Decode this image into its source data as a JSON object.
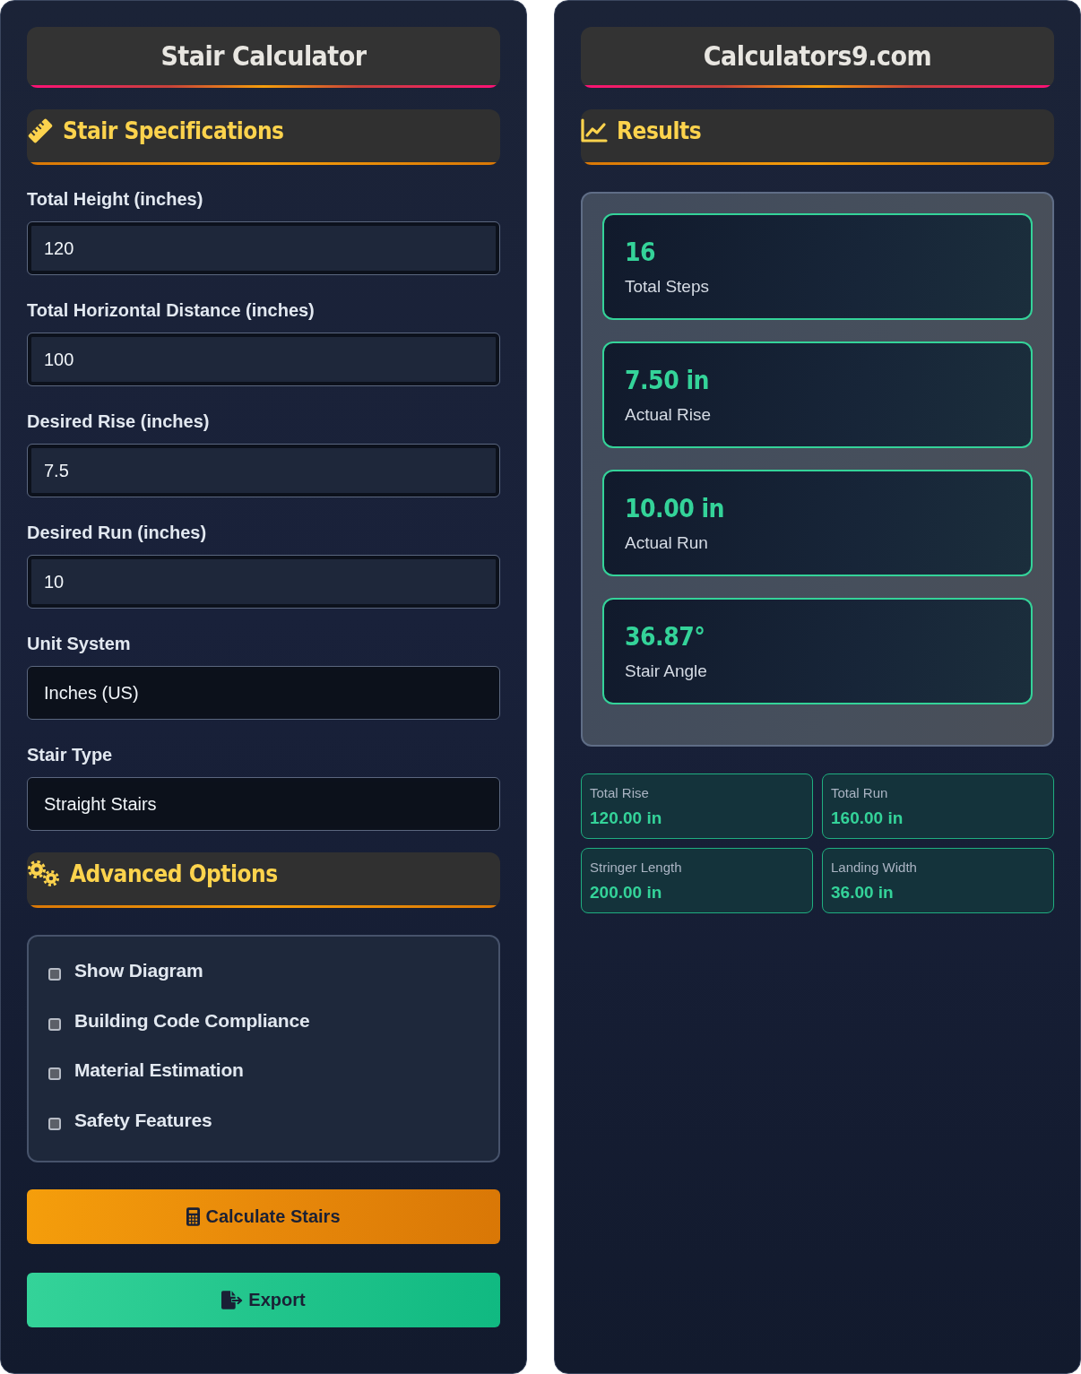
{
  "left_panel": {
    "title": "Stair Calculator",
    "specifications": {
      "heading": "Stair Specifications",
      "fields": [
        {
          "kind": "input",
          "label": "Total Height (inches)",
          "value": "120"
        },
        {
          "kind": "input",
          "label": "Total Horizontal Distance (inches)",
          "value": "100"
        },
        {
          "kind": "input",
          "label": "Desired Rise (inches)",
          "value": "7.5"
        },
        {
          "kind": "input",
          "label": "Desired Run (inches)",
          "value": "10"
        },
        {
          "kind": "select",
          "label": "Unit System",
          "value": "Inches (US)"
        },
        {
          "kind": "select",
          "label": "Stair Type",
          "value": "Straight Stairs"
        }
      ]
    },
    "advanced": {
      "heading": "Advanced Options",
      "options": [
        {
          "label": "Show Diagram",
          "checked": false
        },
        {
          "label": "Building Code Compliance",
          "checked": false
        },
        {
          "label": "Material Estimation",
          "checked": false
        },
        {
          "label": "Safety Features",
          "checked": false
        }
      ]
    },
    "buttons": [
      {
        "kind": "calculate",
        "label": "Calculate Stairs"
      },
      {
        "kind": "export",
        "label": "Export"
      }
    ]
  },
  "right_panel": {
    "title": "Calculators9.com",
    "results": {
      "heading": "Results",
      "cards": [
        {
          "value": "16",
          "label": "Total Steps"
        },
        {
          "value": "7.50 in",
          "label": "Actual Rise"
        },
        {
          "value": "10.00 in",
          "label": "Actual Run"
        },
        {
          "value": "36.87°",
          "label": "Stair Angle"
        }
      ],
      "details": [
        {
          "label": "Total Rise",
          "value": "120.00 in"
        },
        {
          "label": "Total Run",
          "value": "160.00 in"
        },
        {
          "label": "Stringer Length",
          "value": "200.00 in"
        },
        {
          "label": "Landing Width",
          "value": "36.00 in"
        }
      ]
    }
  }
}
